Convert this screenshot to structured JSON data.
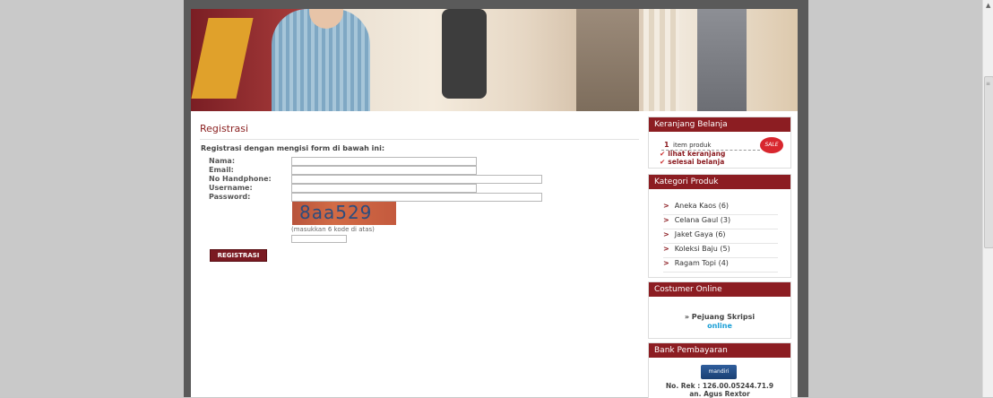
{
  "registrasi": {
    "title": "Registrasi",
    "subtitle": "Registrasi dengan mengisi form di bawah ini:",
    "labels": [
      "Nama:",
      "Email:",
      "No Handphone:",
      "Username:",
      "Password:"
    ],
    "captcha_text": "8aa529",
    "captcha_hint": "(masukkan 6 kode di atas)",
    "button": "REGISTRASI"
  },
  "cart": {
    "title": "Keranjang Belanja",
    "count": "1",
    "count_label": "item produk",
    "link1": "lihat keranjang",
    "link2": "selesai belanja",
    "sale": "SALE"
  },
  "kategori": {
    "title": "Kategori Produk",
    "items": [
      "Aneka Kaos (6)",
      "Celana Gaul (3)",
      "Jaket Gaya (6)",
      "Koleksi Baju (5)",
      "Ragam Topi (4)"
    ]
  },
  "online": {
    "title": "Costumer Online",
    "name": "» Pejuang Skripsi",
    "status": "online"
  },
  "bank": {
    "title": "Bank Pembayaran",
    "logo": "mandiri",
    "rek": "No. Rek : 126.00.05244.71.9",
    "an": "an. Agus Rextor"
  },
  "icons": {
    "check": "check-icon",
    "arrow": "arrow-right-icon"
  }
}
